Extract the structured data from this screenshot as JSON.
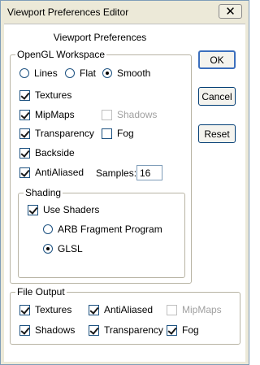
{
  "window": {
    "title": "Viewport Preferences Editor",
    "close_glyph": "✕"
  },
  "heading": "Viewport Preferences",
  "opengl": {
    "label": "OpenGL Workspace",
    "render_mode": {
      "options": [
        "Lines",
        "Flat",
        "Smooth"
      ],
      "selected": "Smooth"
    },
    "textures": {
      "label": "Textures",
      "checked": true
    },
    "mipmaps": {
      "label": "MipMaps",
      "checked": true
    },
    "shadows": {
      "label": "Shadows",
      "checked": false,
      "enabled": false
    },
    "transparency": {
      "label": "Transparency",
      "checked": true
    },
    "fog": {
      "label": "Fog",
      "checked": false
    },
    "backside": {
      "label": "Backside",
      "checked": true
    },
    "antialiased": {
      "label": "AntiAliased",
      "checked": true
    },
    "samples_label": "Samples:",
    "samples_value": "16"
  },
  "shading": {
    "label": "Shading",
    "use_shaders": {
      "label": "Use Shaders",
      "checked": true
    },
    "programs": {
      "options": [
        "ARB Fragment Program",
        "GLSL"
      ],
      "selected": "GLSL"
    }
  },
  "file_output": {
    "label": "File Output",
    "textures": {
      "label": "Textures",
      "checked": true
    },
    "antialiased": {
      "label": "AntiAliased",
      "checked": true
    },
    "mipmaps": {
      "label": "MipMaps",
      "checked": false,
      "enabled": false
    },
    "shadows": {
      "label": "Shadows",
      "checked": true
    },
    "transparency": {
      "label": "Transparency",
      "checked": true
    },
    "fog": {
      "label": "Fog",
      "checked": true
    }
  },
  "buttons": {
    "ok": "OK",
    "cancel": "Cancel",
    "reset": "Reset"
  },
  "colors": {
    "frame": "#ece9d8",
    "client": "#ffffff",
    "default_button_border": "#3c6fbd"
  }
}
